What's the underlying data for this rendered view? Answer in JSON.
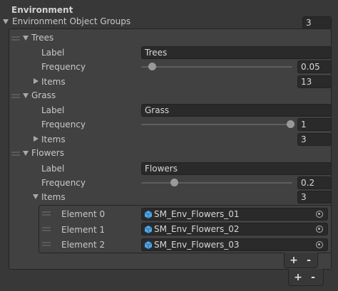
{
  "inspector": {
    "section_title": "Environment",
    "groups_label": "Environment Object Groups",
    "groups_count": "3",
    "labels": {
      "label": "Label",
      "frequency": "Frequency",
      "items": "Items"
    },
    "trees": {
      "name": "Trees",
      "label_value": "Trees",
      "frequency": "0.05",
      "frequency_fraction": 0.05,
      "items_count": "13"
    },
    "grass": {
      "name": "Grass",
      "label_value": "Grass",
      "frequency": "1",
      "frequency_fraction": 1.0,
      "items_count": "3"
    },
    "flowers": {
      "name": "Flowers",
      "label_value": "Flowers",
      "frequency": "0.2",
      "frequency_fraction": 0.2,
      "items_count": "3",
      "elements": [
        {
          "label": "Element 0",
          "value": "SM_Env_Flowers_01"
        },
        {
          "label": "Element 1",
          "value": "SM_Env_Flowers_02"
        },
        {
          "label": "Element 2",
          "value": "SM_Env_Flowers_03"
        }
      ]
    },
    "add_symbol": "+",
    "remove_symbol": "-"
  },
  "icons": {
    "prefab": "prefab-cube-icon",
    "picker": "object-picker-icon",
    "drag": "drag-handle-icon",
    "foldout": "foldout-arrow-icon"
  },
  "colors": {
    "background": "#383838",
    "panel": "#414141",
    "field": "#2a2a2a",
    "prefab_icon": "#4ea6e8"
  }
}
